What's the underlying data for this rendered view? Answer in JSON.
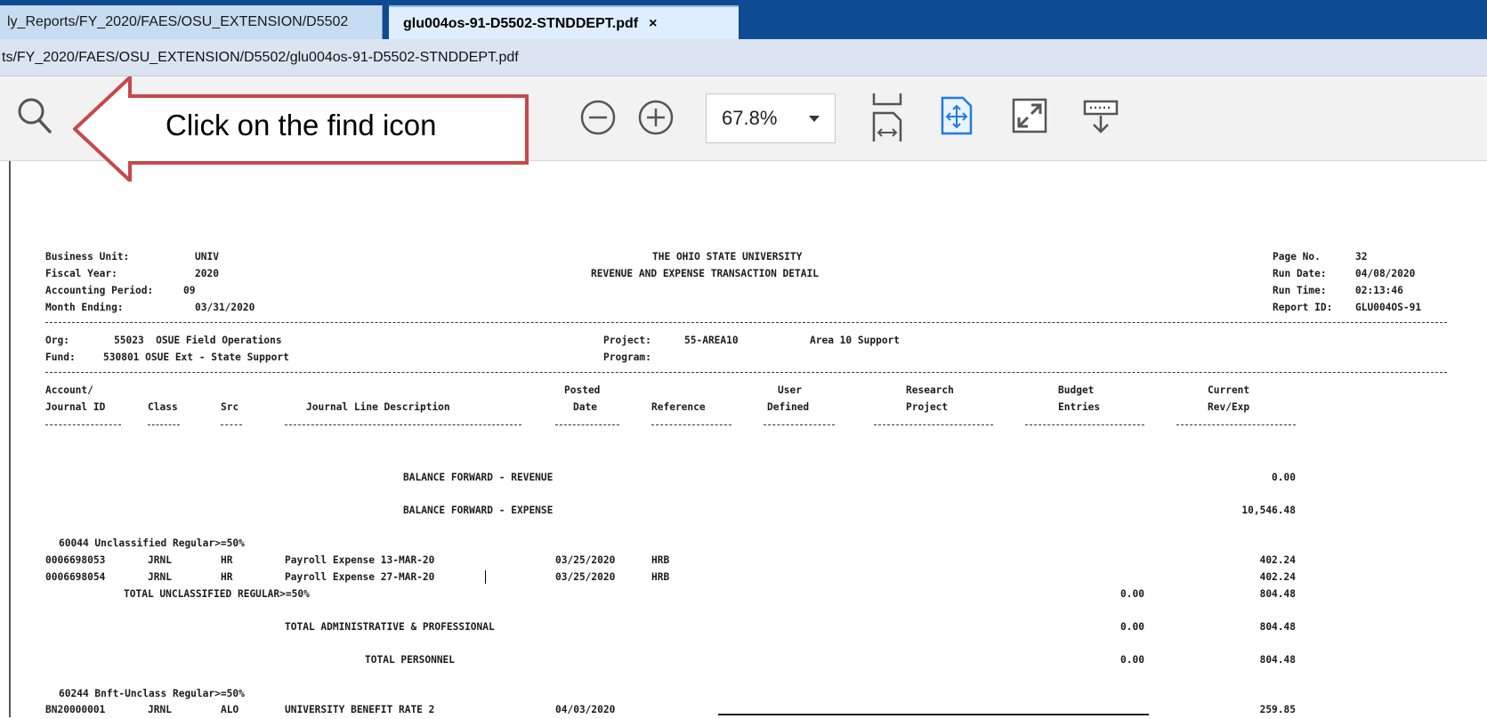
{
  "tabs": [
    {
      "label": "ly_Reports/FY_2020/FAES/OSU_EXTENSION/D5502"
    },
    {
      "label": "glu004os-91-D5502-STNDDEPT.pdf",
      "close": "×"
    }
  ],
  "address": "ts/FY_2020/FAES/OSU_EXTENSION/D5502/glu004os-91-D5502-STNDDEPT.pdf",
  "toolbar": {
    "zoom": "67.8%",
    "icons": [
      "search-icon",
      "hand-icon",
      "zoom-out-icon",
      "zoom-in-icon",
      "fit-width-icon",
      "fit-page-icon",
      "fullscreen-icon",
      "download-icon"
    ]
  },
  "callout": {
    "text": "Click on the find icon"
  },
  "report": {
    "header_left": [
      {
        "label": "Business Unit:",
        "value": "UNIV"
      },
      {
        "label": "Fiscal Year:",
        "value": "2020"
      },
      {
        "label": "Accounting Period:",
        "value": "09"
      },
      {
        "label": "Month Ending:",
        "value": "03/31/2020"
      }
    ],
    "title1": "THE OHIO STATE UNIVERSITY",
    "title2": "REVENUE AND EXPENSE TRANSACTION DETAIL",
    "header_right": [
      {
        "label": "Page No.",
        "value": "32"
      },
      {
        "label": "Run Date:",
        "value": "04/08/2020"
      },
      {
        "label": "Run Time:",
        "value": "02:13:46"
      },
      {
        "label": "Report ID:",
        "value": "GLU004OS-91"
      }
    ],
    "org_label": "Org:",
    "org_value": "55023  OSUE Field Operations",
    "fund_label": "Fund:",
    "fund_value": "530801 OSUE Ext - State Support",
    "project_label": "Project:",
    "project_value": "55-AREA10",
    "project_desc": "Area 10 Support",
    "program_label": "Program:",
    "columns": {
      "account1": "Account/",
      "account2": "Journal ID",
      "class": "Class",
      "src": "Src",
      "desc": "Journal Line Description",
      "posted1": "Posted",
      "posted2": "Date",
      "reference": "Reference",
      "user1": "User",
      "user2": "Defined",
      "research1": "Research",
      "research2": "Project",
      "budget1": "Budget",
      "budget2": "Entries",
      "current1": "Current",
      "current2": "Rev/Exp"
    },
    "balance_rev_label": "BALANCE FORWARD - REVENUE",
    "balance_rev_value": "0.00",
    "balance_exp_label": "BALANCE FORWARD - EXPENSE",
    "balance_exp_value": "10,546.48",
    "group1_title": "60044 Unclassified Regular>=50%",
    "group1_rows": [
      {
        "journal": "0006698053",
        "class": "JRNL",
        "src": "HR",
        "desc": "Payroll Expense 13-MAR-20",
        "date": "03/25/2020",
        "ref": "HRB",
        "amount": "402.24"
      },
      {
        "journal": "0006698054",
        "class": "JRNL",
        "src": "HR",
        "desc": "Payroll Expense 27-MAR-20",
        "date": "03/25/2020",
        "ref": "HRB",
        "amount": "402.24"
      }
    ],
    "total1_label": "TOTAL UNCLASSIFIED REGULAR>=50%",
    "total1_budget": "0.00",
    "total1_amount": "804.48",
    "total2_label": "TOTAL ADMINISTRATIVE & PROFESSIONAL",
    "total2_budget": "0.00",
    "total2_amount": "804.48",
    "total3_label": "TOTAL PERSONNEL",
    "total3_budget": "0.00",
    "total3_amount": "804.48",
    "group2_title": "60244 Bnft-Unclass Regular>=50%",
    "group2_rows": [
      {
        "journal": "BN20000001",
        "class": "JRNL",
        "src": "ALO",
        "desc": "UNIVERSITY BENEFIT RATE 2",
        "date": "04/03/2020",
        "amount": "259.85"
      }
    ]
  }
}
